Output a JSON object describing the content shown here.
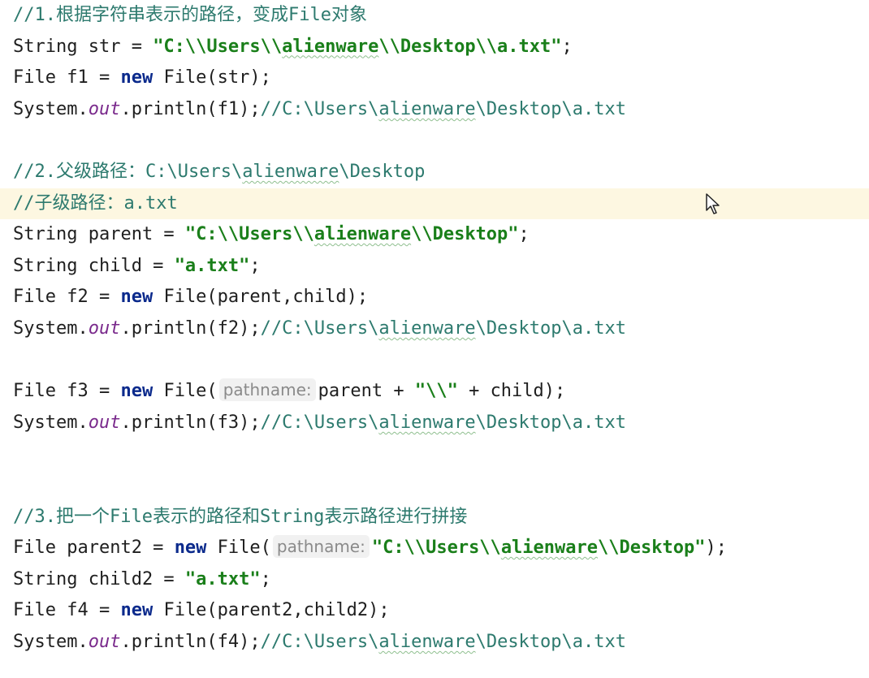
{
  "lines": [
    {
      "current": false,
      "tokens": [
        {
          "t": "comment",
          "v": "//1.根据字符串表示的路径，变成File对象"
        }
      ]
    },
    {
      "current": false,
      "tokens": [
        {
          "t": "plain",
          "v": "String str = "
        },
        {
          "t": "string",
          "v": "\"C:\\\\Users\\\\"
        },
        {
          "t": "string",
          "v": "alienware",
          "typo": true
        },
        {
          "t": "string",
          "v": "\\\\Desktop\\\\a.txt\""
        },
        {
          "t": "plain",
          "v": ";"
        }
      ]
    },
    {
      "current": false,
      "tokens": [
        {
          "t": "plain",
          "v": "File f1 = "
        },
        {
          "t": "keyword",
          "v": "new"
        },
        {
          "t": "plain",
          "v": " File(str);"
        }
      ]
    },
    {
      "current": false,
      "tokens": [
        {
          "t": "plain",
          "v": "System."
        },
        {
          "t": "field",
          "v": "out"
        },
        {
          "t": "plain",
          "v": ".println(f1);"
        },
        {
          "t": "comment",
          "v": "//C:\\Users\\"
        },
        {
          "t": "comment",
          "v": "alienware",
          "typo": true
        },
        {
          "t": "comment",
          "v": "\\Desktop\\a.txt"
        }
      ]
    },
    {
      "current": false,
      "tokens": []
    },
    {
      "current": false,
      "tokens": [
        {
          "t": "comment",
          "v": "//2.父级路径：C:\\Users\\"
        },
        {
          "t": "comment",
          "v": "alienware",
          "typo": true
        },
        {
          "t": "comment",
          "v": "\\Desktop"
        }
      ]
    },
    {
      "current": true,
      "tokens": [
        {
          "t": "comment",
          "v": "//子级路径：a.txt"
        }
      ]
    },
    {
      "current": false,
      "tokens": [
        {
          "t": "plain",
          "v": "String parent = "
        },
        {
          "t": "string",
          "v": "\"C:\\\\Users\\\\"
        },
        {
          "t": "string",
          "v": "alienware",
          "typo": true
        },
        {
          "t": "string",
          "v": "\\\\Desktop\""
        },
        {
          "t": "plain",
          "v": ";"
        }
      ]
    },
    {
      "current": false,
      "tokens": [
        {
          "t": "plain",
          "v": "String child = "
        },
        {
          "t": "string",
          "v": "\"a.txt\""
        },
        {
          "t": "plain",
          "v": ";"
        }
      ]
    },
    {
      "current": false,
      "tokens": [
        {
          "t": "plain",
          "v": "File f2 = "
        },
        {
          "t": "keyword",
          "v": "new"
        },
        {
          "t": "plain",
          "v": " File(parent,child);"
        }
      ]
    },
    {
      "current": false,
      "tokens": [
        {
          "t": "plain",
          "v": "System."
        },
        {
          "t": "field",
          "v": "out"
        },
        {
          "t": "plain",
          "v": ".println(f2);"
        },
        {
          "t": "comment",
          "v": "//C:\\Users\\"
        },
        {
          "t": "comment",
          "v": "alienware",
          "typo": true
        },
        {
          "t": "comment",
          "v": "\\Desktop\\a.txt"
        }
      ]
    },
    {
      "current": false,
      "tokens": []
    },
    {
      "current": false,
      "tokens": [
        {
          "t": "plain",
          "v": "File f3 = "
        },
        {
          "t": "keyword",
          "v": "new"
        },
        {
          "t": "plain",
          "v": " File("
        },
        {
          "t": "hint",
          "v": "pathname:"
        },
        {
          "t": "plain",
          "v": "parent + "
        },
        {
          "t": "string",
          "v": "\"\\\\\""
        },
        {
          "t": "plain",
          "v": " + child);"
        }
      ]
    },
    {
      "current": false,
      "tokens": [
        {
          "t": "plain",
          "v": "System."
        },
        {
          "t": "field",
          "v": "out"
        },
        {
          "t": "plain",
          "v": ".println(f3);"
        },
        {
          "t": "comment",
          "v": "//C:\\Users\\"
        },
        {
          "t": "comment",
          "v": "alienware",
          "typo": true
        },
        {
          "t": "comment",
          "v": "\\Desktop\\a.txt"
        }
      ]
    },
    {
      "current": false,
      "tokens": []
    },
    {
      "current": false,
      "tokens": []
    },
    {
      "current": false,
      "tokens": [
        {
          "t": "comment",
          "v": "//3.把一个File表示的路径和String表示路径进行拼接"
        }
      ]
    },
    {
      "current": false,
      "tokens": [
        {
          "t": "plain",
          "v": "File parent2 = "
        },
        {
          "t": "keyword",
          "v": "new"
        },
        {
          "t": "plain",
          "v": " File("
        },
        {
          "t": "hint",
          "v": "pathname:"
        },
        {
          "t": "string",
          "v": "\"C:\\\\Users\\\\"
        },
        {
          "t": "string",
          "v": "alienware",
          "typo": true
        },
        {
          "t": "string",
          "v": "\\\\Desktop\""
        },
        {
          "t": "plain",
          "v": ");"
        }
      ]
    },
    {
      "current": false,
      "tokens": [
        {
          "t": "plain",
          "v": "String child2 = "
        },
        {
          "t": "string",
          "v": "\"a.txt\""
        },
        {
          "t": "plain",
          "v": ";"
        }
      ]
    },
    {
      "current": false,
      "tokens": [
        {
          "t": "plain",
          "v": "File f4 = "
        },
        {
          "t": "keyword",
          "v": "new"
        },
        {
          "t": "plain",
          "v": " File(parent2,child2);"
        }
      ]
    },
    {
      "current": false,
      "tokens": [
        {
          "t": "plain",
          "v": "System."
        },
        {
          "t": "field",
          "v": "out"
        },
        {
          "t": "plain",
          "v": ".println(f4);"
        },
        {
          "t": "comment",
          "v": "//C:\\Users\\"
        },
        {
          "t": "comment",
          "v": "alienware",
          "typo": true
        },
        {
          "t": "comment",
          "v": "\\Desktop\\a.txt"
        }
      ]
    }
  ],
  "colors": {
    "background": "#ffffff",
    "current_line": "#fdf7e1",
    "comment": "#2d7a6e",
    "string": "#1a7f1a",
    "keyword": "#0b2a8c",
    "field": "#7a2a8c",
    "inlay_hint": "#8a8a8a"
  },
  "icons": {
    "mouse_cursor": "arrow-pointer-icon"
  }
}
